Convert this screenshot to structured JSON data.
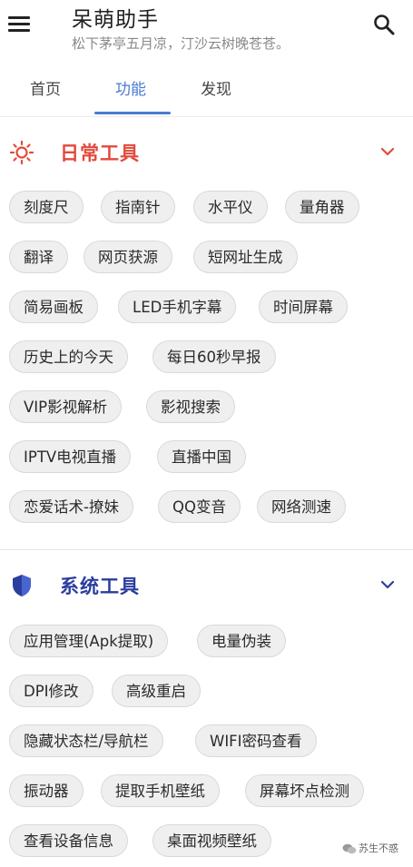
{
  "app": {
    "title": "呆萌助手",
    "subtitle": "松下茅亭五月凉，汀沙云树晚苍苍。"
  },
  "tabs": [
    {
      "label": "首页",
      "active": false
    },
    {
      "label": "功能",
      "active": true
    },
    {
      "label": "发现",
      "active": false
    }
  ],
  "colors": {
    "accent": "#4a7bd0",
    "daily": "#e24a3b",
    "system": "#2b3d9e"
  },
  "sections": [
    {
      "title": "日常工具",
      "icon": "sun-icon",
      "items": [
        "刻度尺",
        "指南针",
        "水平仪",
        "量角器",
        "翻译",
        "网页获源",
        "短网址生成",
        "简易画板",
        "LED手机字幕",
        "时间屏幕",
        "历史上的今天",
        "每日60秒早报",
        "VIP影视解析",
        "影视搜索",
        "IPTV电视直播",
        "直播中国",
        "恋爱话术-撩妹",
        "QQ变音",
        "网络测速"
      ]
    },
    {
      "title": "系统工具",
      "icon": "shield-icon",
      "items": [
        "应用管理(Apk提取)",
        "电量伪装",
        "DPI修改",
        "高级重启",
        "隐藏状态栏/导航栏",
        "WIFI密码查看",
        "振动器",
        "提取手机壁纸",
        "屏幕坏点检测",
        "查看设备信息",
        "桌面视频壁纸"
      ]
    }
  ],
  "watermark": "苏生不惑"
}
